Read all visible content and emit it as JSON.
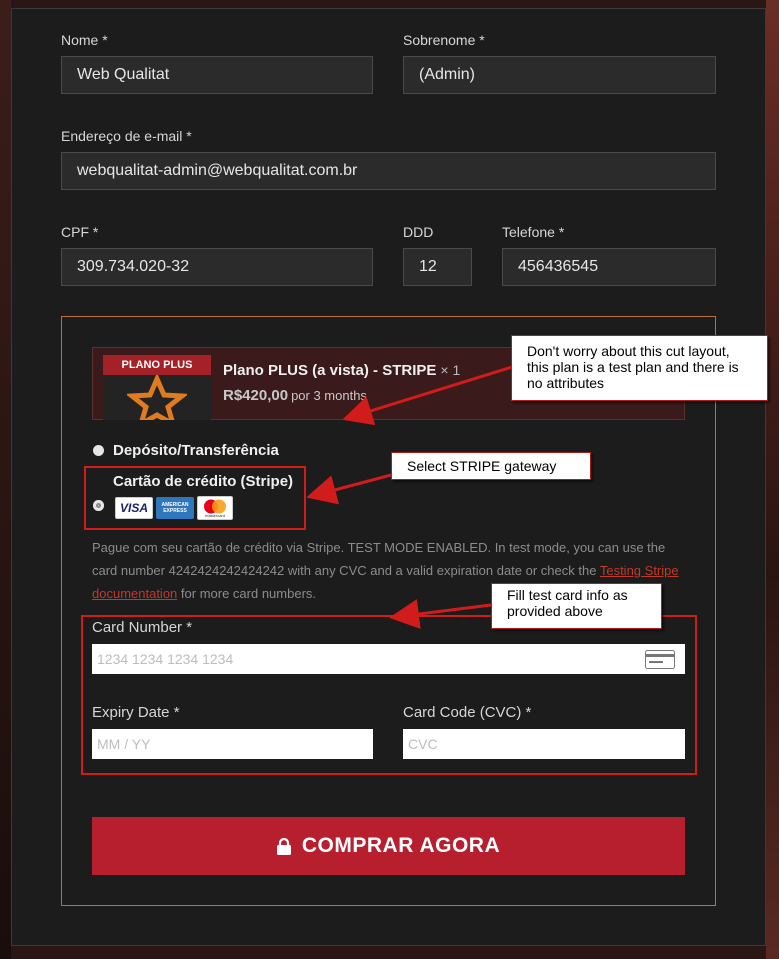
{
  "form": {
    "first_name": {
      "label": "Nome",
      "required_mark": "*",
      "value": "Web Qualitat"
    },
    "last_name": {
      "label": "Sobrenome",
      "required_mark": "*",
      "value": "(Admin)"
    },
    "email": {
      "label": "Endereço de e-mail",
      "required_mark": "*",
      "value": "webqualitat-admin@webqualitat.com.br"
    },
    "cpf": {
      "label": "CPF",
      "required_mark": "*",
      "value": "309.734.020-32"
    },
    "ddd": {
      "label": "DDD",
      "value": "12"
    },
    "phone": {
      "label": "Telefone",
      "required_mark": "*",
      "value": "456436545"
    }
  },
  "order": {
    "thumb_label": "PLANO PLUS",
    "product_name": "Plano PLUS (a vista) - STRIPE",
    "quantity": "× 1",
    "price": "R$420,00",
    "period": "por 3 months"
  },
  "payment": {
    "option_transfer": "Depósito/Transferência",
    "option_card": "Cartão de crédito (Stripe)",
    "selected": "Cartão de crédito (Stripe)",
    "logos": [
      "VISA",
      "AMERICAN EXPRESS",
      "mastercard"
    ],
    "description_text": "Pague com seu cartão de crédito via Stripe. TEST MODE ENABLED. In test mode, you can use the card number 4242424242424242 with any CVC and a valid expiration date or check the",
    "description_link": "Testing Stripe documentation",
    "description_end": "for more card numbers.",
    "card_number": {
      "label": "Card Number *",
      "placeholder": "1234 1234 1234 1234"
    },
    "expiry": {
      "label": "Expiry Date *",
      "placeholder": "MM / YY"
    },
    "cvc": {
      "label": "Card Code (CVC) *",
      "placeholder": "CVC"
    }
  },
  "buy_button": "COMPRAR AGORA",
  "annotations": {
    "note_layout": "Don't worry about this cut layout, this plan is a test plan and there is no attributes",
    "note_gateway": "Select STRIPE gateway",
    "note_card": "Fill test card info as provided above"
  },
  "colors": {
    "accent": "#b81f2e",
    "callout_border": "#d21c1c",
    "order_border": "#b8703c"
  }
}
